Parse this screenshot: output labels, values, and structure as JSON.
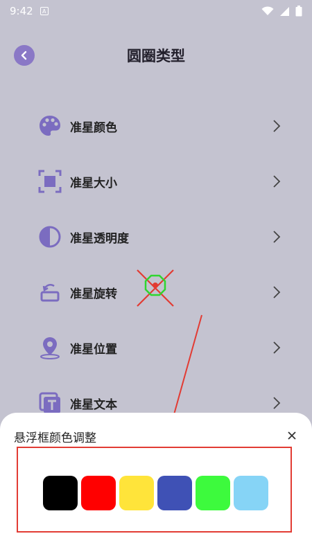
{
  "status": {
    "time": "9:42",
    "notification_label": "A",
    "icons": [
      "wifi-icon",
      "signal-icon",
      "battery-icon"
    ]
  },
  "header": {
    "title": "圆圈类型",
    "back_icon": "chevron-left-icon"
  },
  "menu": {
    "items": [
      {
        "label": "准星颜色",
        "icon": "palette-icon"
      },
      {
        "label": "准星大小",
        "icon": "resize-icon"
      },
      {
        "label": "准星透明度",
        "icon": "contrast-icon"
      },
      {
        "label": "准星旋转",
        "icon": "rotate-icon"
      },
      {
        "label": "准星位置",
        "icon": "location-pin-icon"
      },
      {
        "label": "准星文本",
        "icon": "text-icon"
      }
    ]
  },
  "sheet": {
    "title": "悬浮框颜色调整",
    "close_icon": "close-icon",
    "swatches": [
      {
        "color": "#000000",
        "name": "black"
      },
      {
        "color": "#ff0000",
        "name": "red"
      },
      {
        "color": "#ffe43a",
        "name": "yellow"
      },
      {
        "color": "#3f51b5",
        "name": "blue"
      },
      {
        "color": "#3dfa3d",
        "name": "green"
      },
      {
        "color": "#86d4f6",
        "name": "light-blue"
      }
    ]
  },
  "colors": {
    "accent": "#7b6cc0",
    "background": "#c4c3d0",
    "annotation": "#e23b33"
  }
}
